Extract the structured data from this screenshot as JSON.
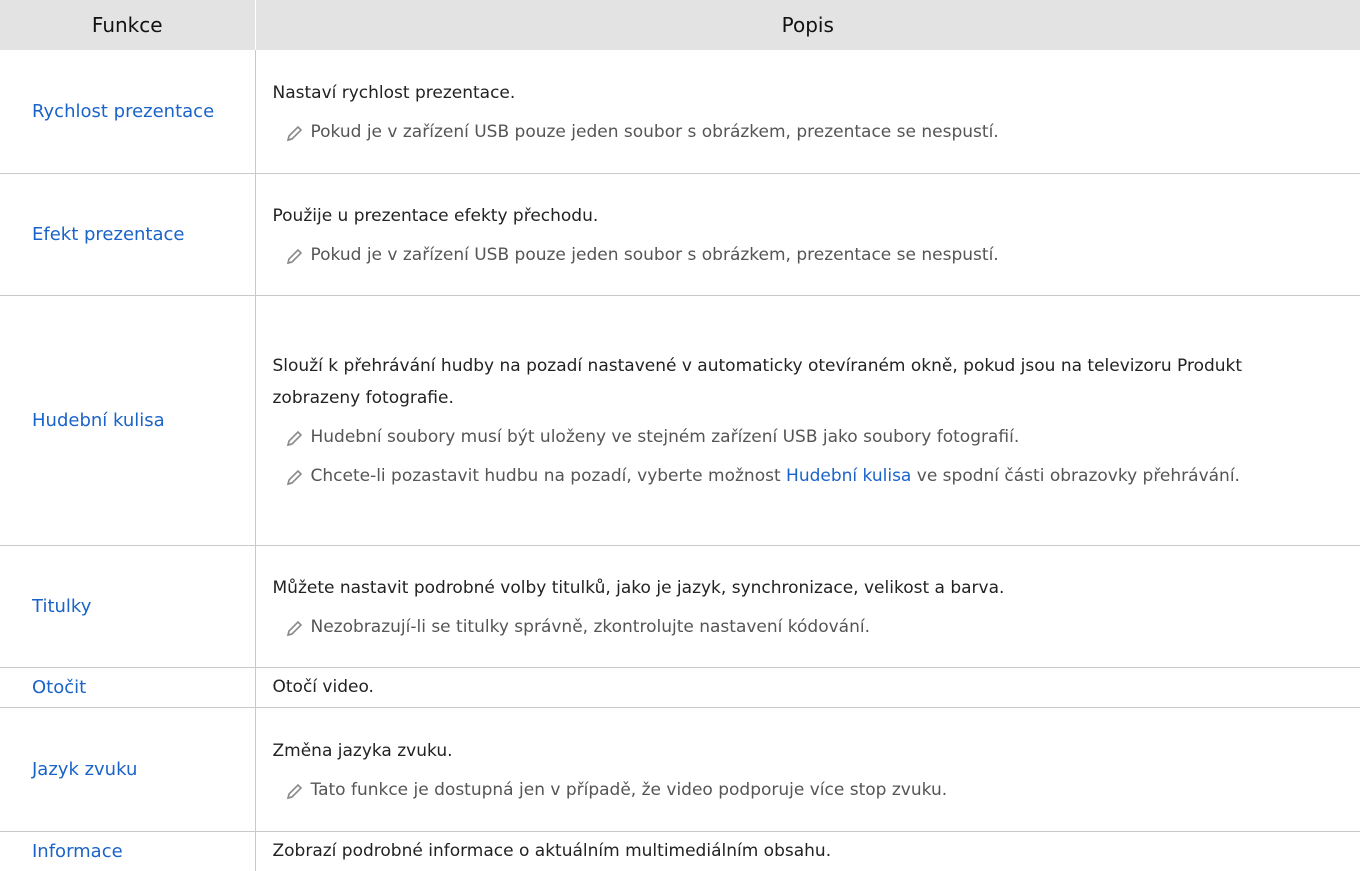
{
  "header": {
    "col_feature": "Funkce",
    "col_description": "Popis"
  },
  "rows": [
    {
      "name": "Rychlost prezentace",
      "description": "Nastaví rychlost prezentace.",
      "notes": [
        "Pokud je v zařízení USB pouze jeden soubor s obrázkem, prezentace se nespustí."
      ]
    },
    {
      "name": "Efekt prezentace",
      "description": "Použije u prezentace efekty přechodu.",
      "notes": [
        "Pokud je v zařízení USB pouze jeden soubor s obrázkem, prezentace se nespustí."
      ]
    },
    {
      "name": "Hudební kulisa",
      "description": "Slouží k přehrávání hudby na pozadí nastavené v automaticky otevíraném okně, pokud jsou na televizoru Produkt zobrazeny fotografie.",
      "notes": [
        "Hudební soubory musí být uloženy ve stejném zařízení USB jako soubory fotografií.",
        {
          "before": "Chcete-li pozastavit hudbu na pozadí, vyberte možnost ",
          "highlight": "Hudební kulisa",
          "after": " ve spodní části obrazovky přehrávání."
        }
      ]
    },
    {
      "name": "Titulky",
      "description": "Můžete nastavit podrobné volby titulků, jako je jazyk, synchronizace, velikost a barva.",
      "notes": [
        "Nezobrazují-li se titulky správně, zkontrolujte nastavení kódování."
      ]
    },
    {
      "name": "Otočit",
      "description": "Otočí video."
    },
    {
      "name": "Jazyk zvuku",
      "description": "Změna jazyka zvuku.",
      "notes": [
        "Tato funkce je dostupná jen v případě, že video podporuje více stop zvuku."
      ]
    },
    {
      "name": "Informace",
      "description": "Zobrazí podrobné informace o aktuálním multimediálním obsahu."
    }
  ],
  "colors": {
    "accent": "#1a63c9",
    "header_bg": "#e3e3e3",
    "grid": "#c9c9c9"
  }
}
